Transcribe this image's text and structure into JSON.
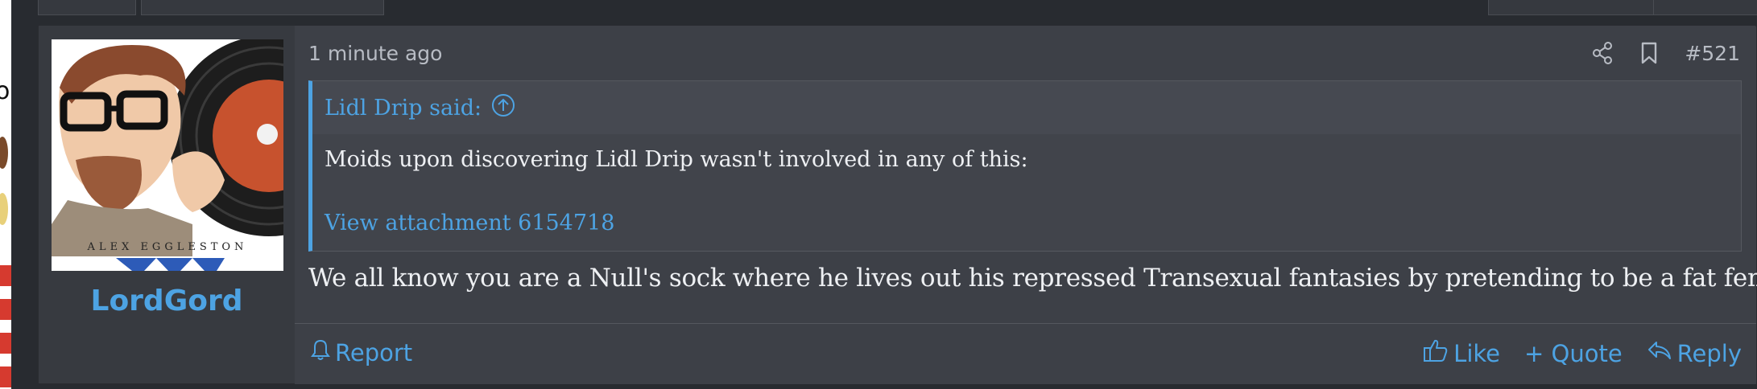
{
  "post": {
    "timestamp": "1 minute ago",
    "number": "#521",
    "author": {
      "username": "LordGord",
      "avatar_caption": "ALEX EGGLESTON"
    },
    "quote": {
      "header": "Lidl Drip said:",
      "text": "Moids upon discovering Lidl Drip wasn't involved in any of this:",
      "attachment_link": "View attachment 6154718"
    },
    "body": "We all know you are a Null's sock where he lives out his repressed Transexual fantasies by pretending to be a fat femcel",
    "footer": {
      "report_label": "Report",
      "like_label": "Like",
      "quote_label": "+ Quote",
      "reply_label": "Reply"
    }
  },
  "colors": {
    "accent": "#4da3e3",
    "card_bg": "#3d4047",
    "user_col_bg": "#373a40",
    "text": "#eef0f3",
    "muted": "#b8bcc4"
  },
  "icons": [
    "share-icon",
    "bookmark-icon",
    "arrow-up-circle-icon",
    "bell-icon",
    "thumbs-up-icon",
    "reply-arrow-icon"
  ]
}
